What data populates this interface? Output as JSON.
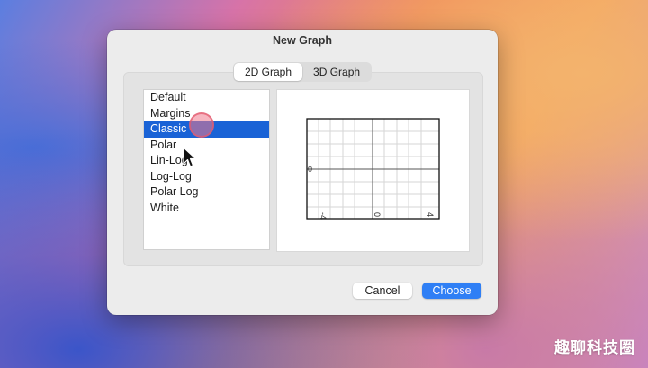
{
  "dialog": {
    "title": "New Graph",
    "tabs": [
      {
        "label": "2D Graph",
        "active": true
      },
      {
        "label": "3D Graph",
        "active": false
      }
    ],
    "templates": [
      {
        "label": "Default",
        "selected": false
      },
      {
        "label": "Margins",
        "selected": false
      },
      {
        "label": "Classic",
        "selected": true
      },
      {
        "label": "Polar",
        "selected": false
      },
      {
        "label": "Lin-Log",
        "selected": false
      },
      {
        "label": "Log-Log",
        "selected": false
      },
      {
        "label": "Polar Log",
        "selected": false
      },
      {
        "label": "White",
        "selected": false
      }
    ],
    "preview": {
      "y_tick_label": "0",
      "x_tick_labels": [
        "-4",
        "0",
        "4"
      ]
    },
    "buttons": {
      "cancel": "Cancel",
      "choose": "Choose"
    }
  },
  "watermark": "趣聊科技圈",
  "colors": {
    "selection": "#1a63d6",
    "accent_button": "#2f7ff5",
    "click_indicator": "#f0788c"
  }
}
